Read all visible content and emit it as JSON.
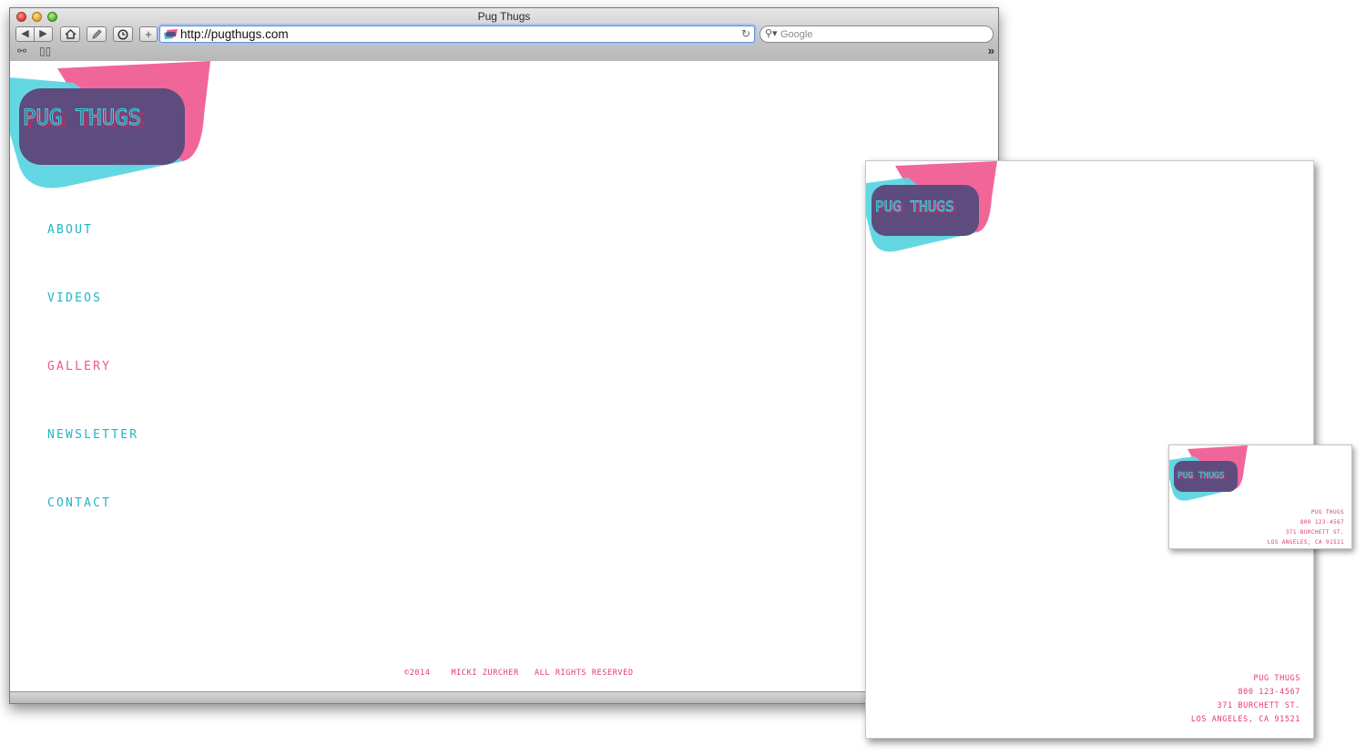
{
  "browser": {
    "window_title": "Pug Thugs",
    "url": "http://pugthugs.com",
    "search_placeholder": "Google",
    "toolbar_icons": [
      "back-icon",
      "forward-icon",
      "home-icon",
      "edit-icon",
      "history-icon",
      "add-tab-icon",
      "reload-icon",
      "search-icon",
      "reading-glasses-icon",
      "bookmarks-book-icon",
      "overflow-chevrons-icon"
    ]
  },
  "site": {
    "logo_text": "PUG THUGS",
    "nav": [
      {
        "label": "ABOUT",
        "active": false
      },
      {
        "label": "VIDEOS",
        "active": false
      },
      {
        "label": "GALLERY",
        "active": true
      },
      {
        "label": "NEWSLETTER",
        "active": false
      },
      {
        "label": "CONTACT",
        "active": false
      }
    ],
    "footer": {
      "copyright": "©2014",
      "author": "MICKI ZURCHER",
      "rights": "ALL RIGHTS RESERVED"
    }
  },
  "letterhead": {
    "logo_text": "PUG THUGS",
    "address_lines": [
      "PUG THUGS",
      "800 123-4567",
      "371 BURCHETT ST.",
      "LOS ANGELES, CA 91521"
    ]
  },
  "business_card": {
    "logo_text": "PUG THUGS",
    "address_lines": [
      "PUG THUGS",
      "800 123-4567",
      "371 BURCHETT ST.",
      "LOS ANGELES, CA 91521"
    ]
  },
  "colors": {
    "brand_pink": "#f0558e",
    "brand_cyan": "#21b6c7",
    "logo_purple": "#5e4c7e"
  }
}
